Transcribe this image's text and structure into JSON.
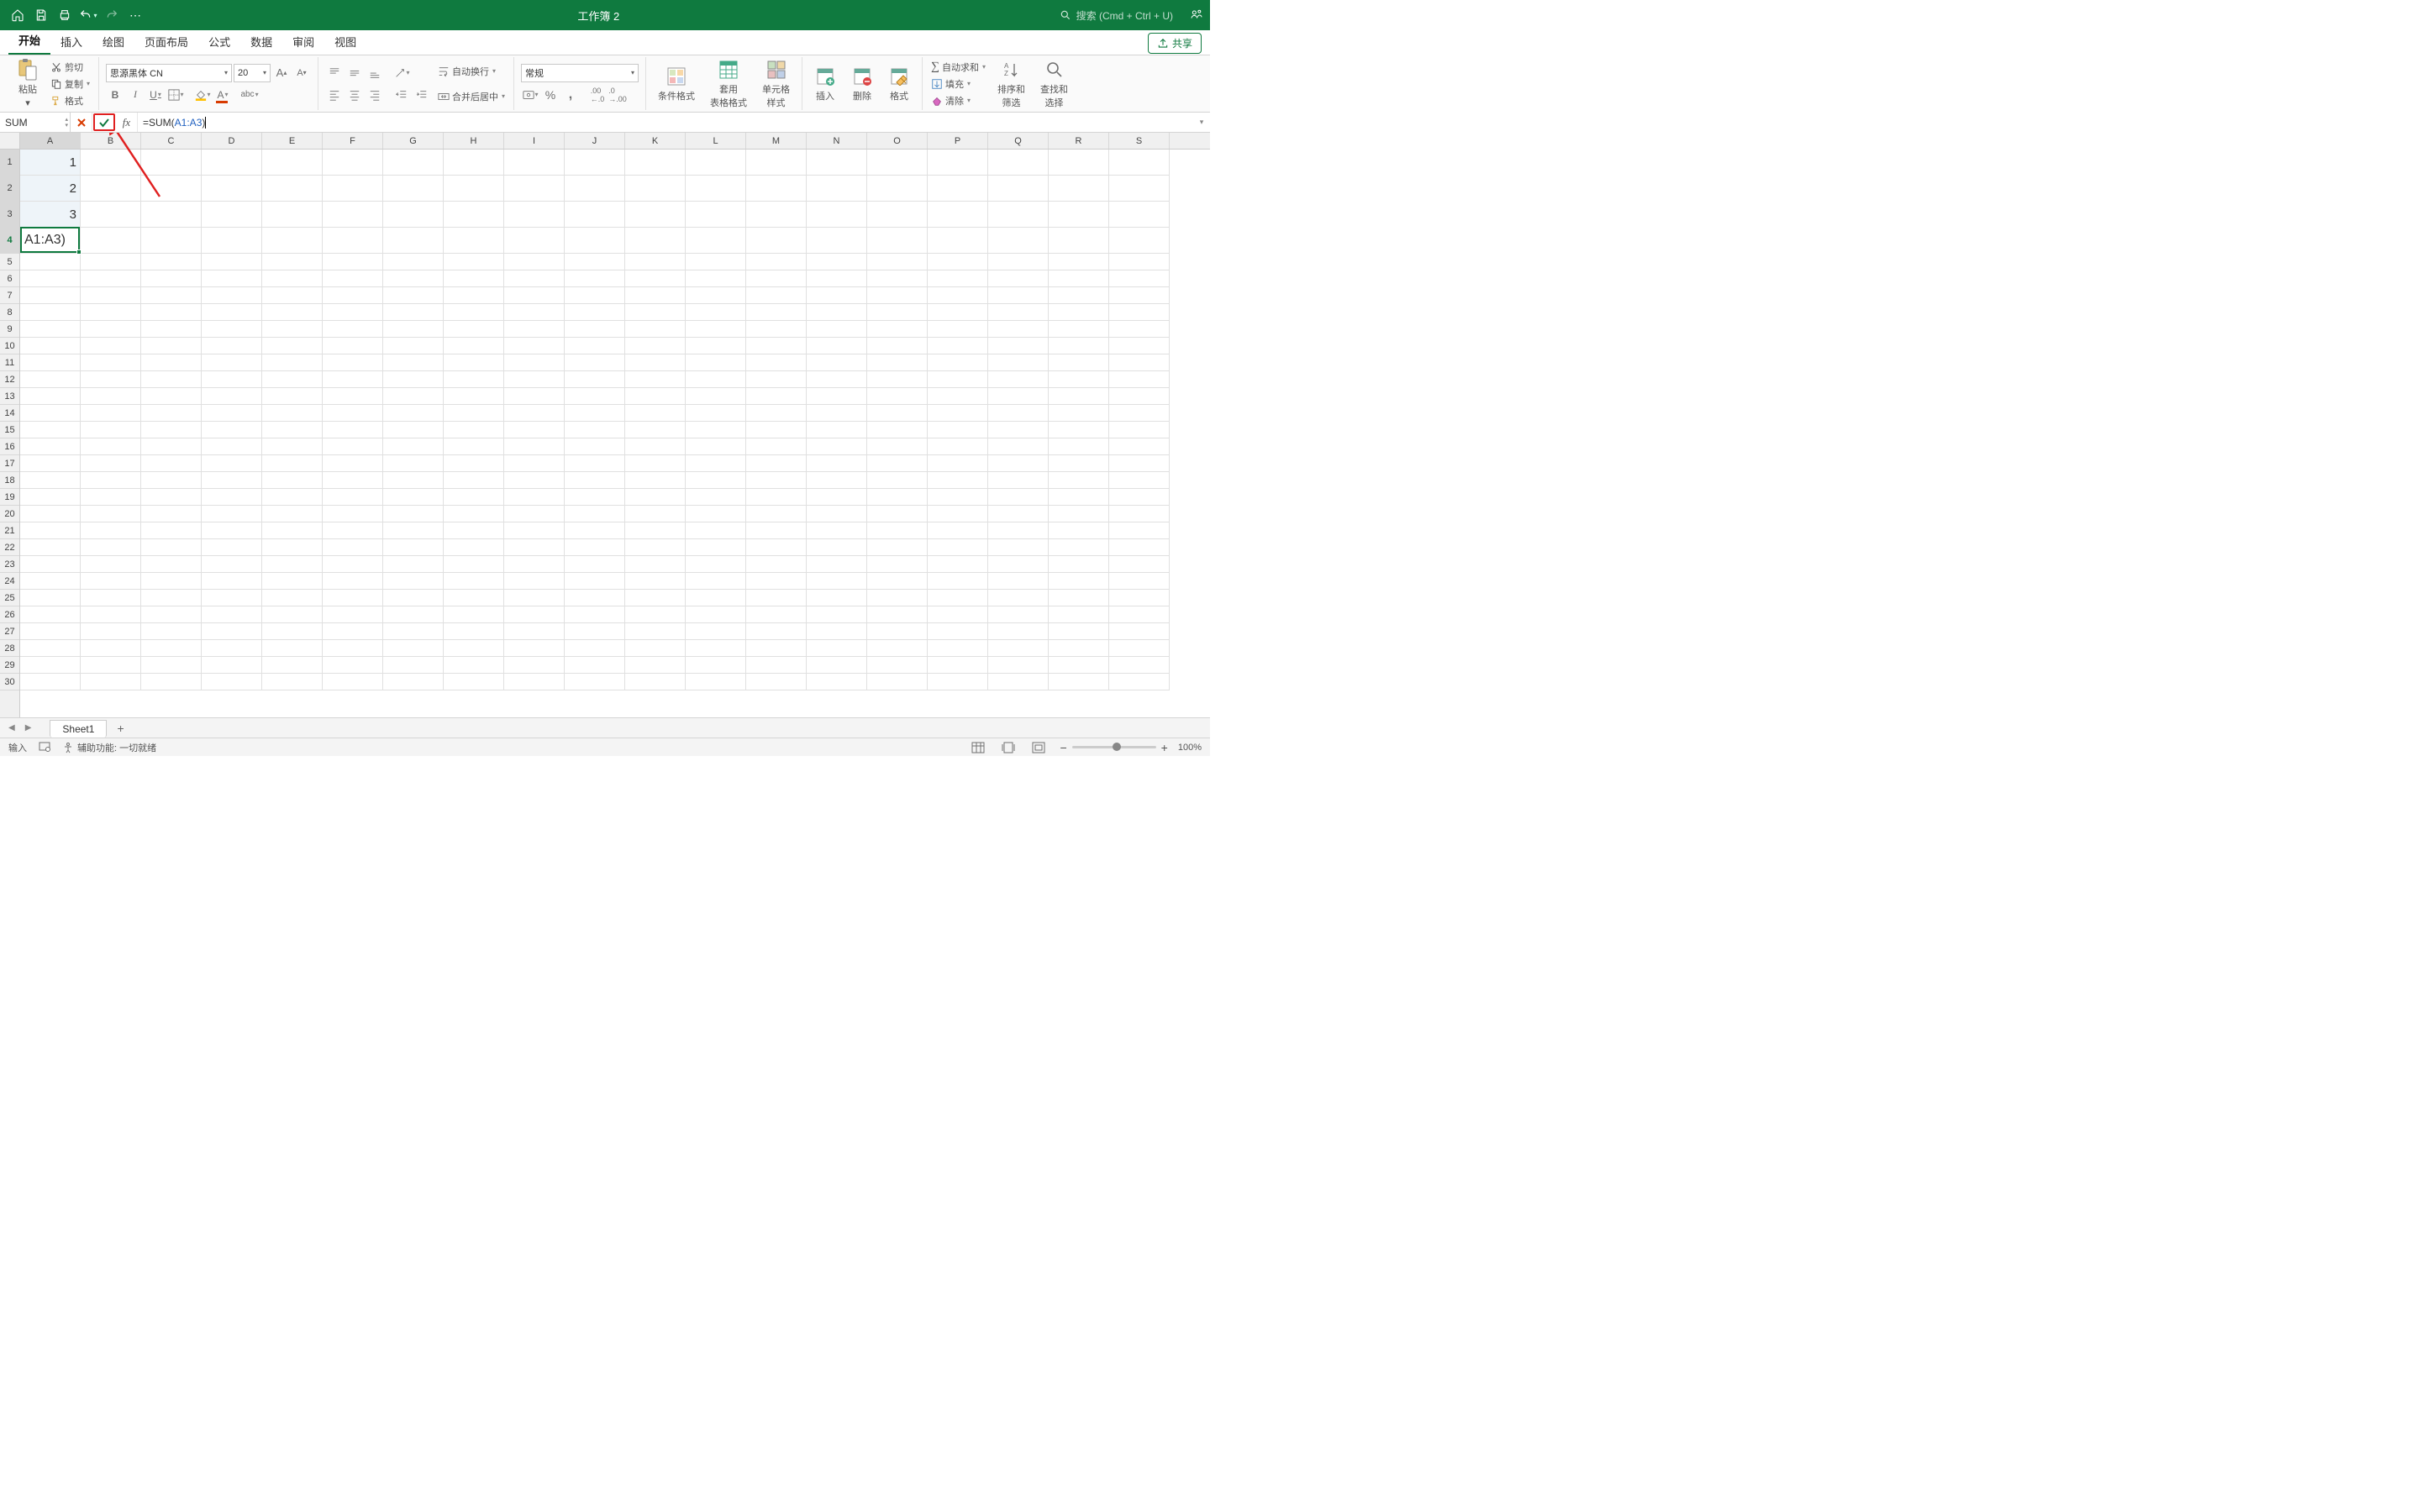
{
  "titlebar": {
    "title": "工作簿 2",
    "search_placeholder": "搜索 (Cmd + Ctrl + U)"
  },
  "tabs": {
    "items": [
      "开始",
      "插入",
      "绘图",
      "页面布局",
      "公式",
      "数据",
      "审阅",
      "视图"
    ],
    "active": "开始",
    "share_label": "共享"
  },
  "ribbon": {
    "paste_label": "粘贴",
    "cut_label": "剪切",
    "copy_label": "复制",
    "format_label": "格式",
    "font_name": "思源黑体 CN",
    "font_size": "20",
    "wrap_label": "自动换行",
    "merge_label": "合并后居中",
    "number_format": "常规",
    "cond_format_label": "条件格式",
    "table_format_label": "套用\n表格格式",
    "cell_style_label": "单元格\n样式",
    "insert_label": "插入",
    "delete_label": "删除",
    "format2_label": "格式",
    "autosum_label": "自动求和",
    "fill_label": "填充",
    "clear_label": "清除",
    "sort_label": "排序和\n筛选",
    "find_label": "查找和\n选择"
  },
  "formula_bar": {
    "name_box": "SUM",
    "formula_prefix": "=SUM(",
    "formula_range": "A1:A3",
    "formula_suffix": ")"
  },
  "grid": {
    "columns": [
      "A",
      "B",
      "C",
      "D",
      "E",
      "F",
      "G",
      "H",
      "I",
      "J",
      "K",
      "L",
      "M",
      "N",
      "O",
      "P",
      "Q",
      "R",
      "S"
    ],
    "rows": 30,
    "tall_rows": [
      1,
      2,
      3,
      4
    ],
    "selected_range_rows": [
      1,
      2,
      3
    ],
    "active_row": 4,
    "active_col": "A",
    "cells": {
      "A1": "1",
      "A2": "2",
      "A3": "3"
    },
    "active_cell_display": "A1:A3)"
  },
  "sheets": {
    "active": "Sheet1"
  },
  "status": {
    "mode": "输入",
    "accessibility": "辅助功能: 一切就绪",
    "zoom": "100%"
  }
}
